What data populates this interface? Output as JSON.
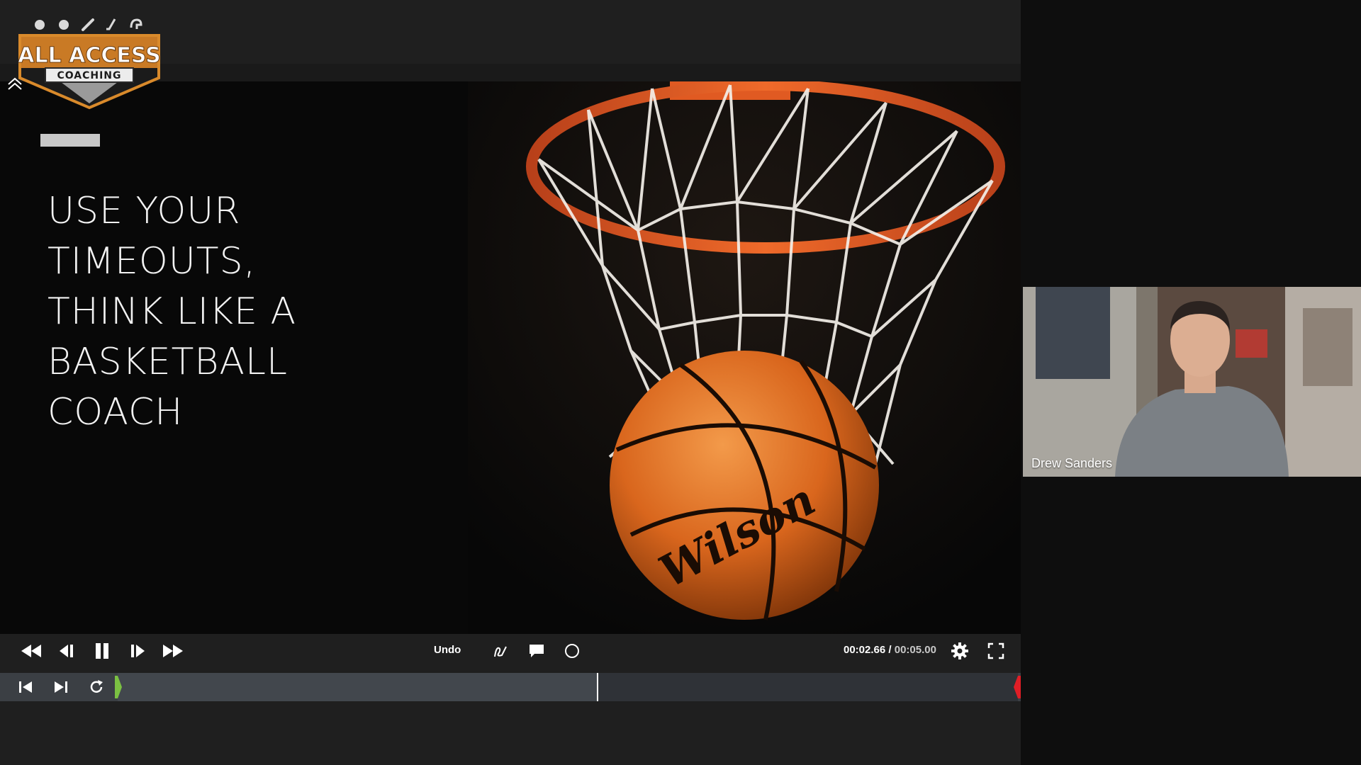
{
  "logo": {
    "line1": "ALL ACCESS",
    "line2": "COACHING",
    "icons": [
      "baseball-icon",
      "softball-icon",
      "bat-icon",
      "hockey-stick-icon",
      "helmet-icon"
    ]
  },
  "slide": {
    "title": "USE YOUR\nTIMEOUTS,\nTHINK LIKE A\nBASKETBALL\nCOACH",
    "ball_brand": "Wilson"
  },
  "toolbar": {
    "undo_label": "Undo",
    "current_time": "00:02.66",
    "separator": " / ",
    "total_time": "00:05.00"
  },
  "timeline": {
    "progress": 0.532
  },
  "webcam": {
    "participant_name": "Drew Sanders"
  },
  "colors": {
    "accent_orange": "#d98a2b",
    "start_marker": "#7bc142",
    "end_marker": "#e01e26"
  }
}
